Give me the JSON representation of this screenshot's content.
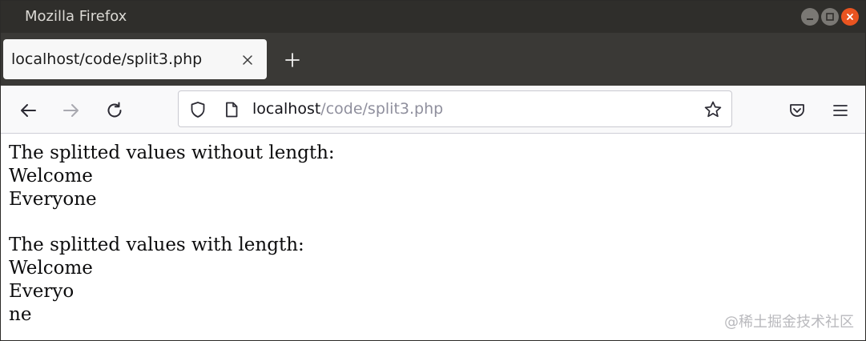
{
  "window": {
    "title": "Mozilla Firefox"
  },
  "tabs": [
    {
      "label": "localhost/code/split3.php",
      "active": true
    }
  ],
  "toolbar": {
    "url_host": "localhost",
    "url_path": "/code/split3.php"
  },
  "content": {
    "section1_heading": "The splitted values without length:",
    "section1_values": [
      "Welcome",
      "Everyone"
    ],
    "section2_heading": "The splitted values with length:",
    "section2_values": [
      "Welcome",
      "Everyo",
      "ne"
    ]
  },
  "watermark": "@稀土掘金技术社区",
  "icons": {
    "back": "arrow-left-icon",
    "forward": "arrow-right-icon",
    "reload": "reload-icon",
    "shield": "shield-icon",
    "page": "page-icon",
    "bookmark": "star-icon",
    "pocket": "pocket-icon",
    "menu": "hamburger-menu-icon",
    "tab_close": "close-icon",
    "new_tab": "plus-icon"
  },
  "colors": {
    "titlebar": "#2f2e2b",
    "tabstrip": "#3a3936",
    "close_button": "#e95420"
  }
}
